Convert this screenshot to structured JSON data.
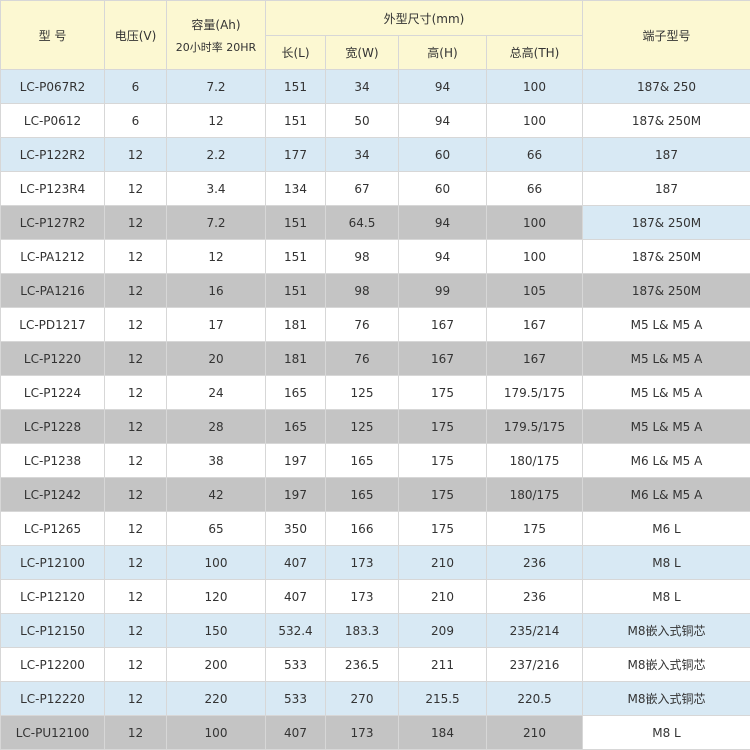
{
  "header": {
    "model": "型 号",
    "voltage": "电压(V)",
    "capacity_top": "容量(Ah)",
    "capacity_sub": "20小时率  20HR",
    "dimensions": "外型尺寸(mm)",
    "length": "长(L)",
    "width": "宽(W)",
    "height": "高(H)",
    "total_height": "总高(TH)",
    "terminal": "端子型号"
  },
  "rows": [
    {
      "model": "LC-P067R2",
      "voltage": "6",
      "capacity": "7.2",
      "length": "151",
      "width": "34",
      "height": "94",
      "total_height": "100",
      "terminal": "187& 250",
      "row_style": "blue",
      "terminal_style": "blue"
    },
    {
      "model": "LC-P0612",
      "voltage": "6",
      "capacity": "12",
      "length": "151",
      "width": "50",
      "height": "94",
      "total_height": "100",
      "terminal": "187& 250M",
      "row_style": "white",
      "terminal_style": "white"
    },
    {
      "model": "LC-P122R2",
      "voltage": "12",
      "capacity": "2.2",
      "length": "177",
      "width": "34",
      "height": "60",
      "total_height": "66",
      "terminal": "187",
      "row_style": "blue",
      "terminal_style": "blue"
    },
    {
      "model": "LC-P123R4",
      "voltage": "12",
      "capacity": "3.4",
      "length": "134",
      "width": "67",
      "height": "60",
      "total_height": "66",
      "terminal": "187",
      "row_style": "white",
      "terminal_style": "white"
    },
    {
      "model": "LC-P127R2",
      "voltage": "12",
      "capacity": "7.2",
      "length": "151",
      "width": "64.5",
      "height": "94",
      "total_height": "100",
      "terminal": "187& 250M",
      "row_style": "gray",
      "terminal_style": "blue"
    },
    {
      "model": "LC-PA1212",
      "voltage": "12",
      "capacity": "12",
      "length": "151",
      "width": "98",
      "height": "94",
      "total_height": "100",
      "terminal": "187& 250M",
      "row_style": "white",
      "terminal_style": "white"
    },
    {
      "model": "LC-PA1216",
      "voltage": "12",
      "capacity": "16",
      "length": "151",
      "width": "98",
      "height": "99",
      "total_height": "105",
      "terminal": "187& 250M",
      "row_style": "gray",
      "terminal_style": "gray"
    },
    {
      "model": "LC-PD1217",
      "voltage": "12",
      "capacity": "17",
      "length": "181",
      "width": "76",
      "height": "167",
      "total_height": "167",
      "terminal": "M5 L& M5 A",
      "row_style": "white",
      "terminal_style": "white"
    },
    {
      "model": "LC-P1220",
      "voltage": "12",
      "capacity": "20",
      "length": "181",
      "width": "76",
      "height": "167",
      "total_height": "167",
      "terminal": "M5 L& M5 A",
      "row_style": "gray",
      "terminal_style": "gray"
    },
    {
      "model": "LC-P1224",
      "voltage": "12",
      "capacity": "24",
      "length": "165",
      "width": "125",
      "height": "175",
      "total_height": "179.5/175",
      "terminal": "M5 L& M5 A",
      "row_style": "white",
      "terminal_style": "white"
    },
    {
      "model": "LC-P1228",
      "voltage": "12",
      "capacity": "28",
      "length": "165",
      "width": "125",
      "height": "175",
      "total_height": "179.5/175",
      "terminal": "M5 L& M5 A",
      "row_style": "gray",
      "terminal_style": "gray"
    },
    {
      "model": "LC-P1238",
      "voltage": "12",
      "capacity": "38",
      "length": "197",
      "width": "165",
      "height": "175",
      "total_height": "180/175",
      "terminal": "M6 L& M5 A",
      "row_style": "white",
      "terminal_style": "white"
    },
    {
      "model": "LC-P1242",
      "voltage": "12",
      "capacity": "42",
      "length": "197",
      "width": "165",
      "height": "175",
      "total_height": "180/175",
      "terminal": "M6 L& M5 A",
      "row_style": "gray",
      "terminal_style": "gray"
    },
    {
      "model": "LC-P1265",
      "voltage": "12",
      "capacity": "65",
      "length": "350",
      "width": "166",
      "height": "175",
      "total_height": "175",
      "terminal": "M6 L",
      "row_style": "white",
      "terminal_style": "white"
    },
    {
      "model": "LC-P12100",
      "voltage": "12",
      "capacity": "100",
      "length": "407",
      "width": "173",
      "height": "210",
      "total_height": "236",
      "terminal": "M8 L",
      "row_style": "blue",
      "terminal_style": "blue"
    },
    {
      "model": "LC-P12120",
      "voltage": "12",
      "capacity": "120",
      "length": "407",
      "width": "173",
      "height": "210",
      "total_height": "236",
      "terminal": "M8 L",
      "row_style": "white",
      "terminal_style": "white"
    },
    {
      "model": "LC-P12150",
      "voltage": "12",
      "capacity": "150",
      "length": "532.4",
      "width": "183.3",
      "height": "209",
      "total_height": "235/214",
      "terminal": "M8嵌入式铜芯",
      "row_style": "blue",
      "terminal_style": "blue"
    },
    {
      "model": "LC-P12200",
      "voltage": "12",
      "capacity": "200",
      "length": "533",
      "width": "236.5",
      "height": "211",
      "total_height": "237/216",
      "terminal": "M8嵌入式铜芯",
      "row_style": "white",
      "terminal_style": "white"
    },
    {
      "model": "LC-P12220",
      "voltage": "12",
      "capacity": "220",
      "length": "533",
      "width": "270",
      "height": "215.5",
      "total_height": "220.5",
      "terminal": "M8嵌入式铜芯",
      "row_style": "blue",
      "terminal_style": "blue"
    },
    {
      "model": "LC-PU12100",
      "voltage": "12",
      "capacity": "100",
      "length": "407",
      "width": "173",
      "height": "184",
      "total_height": "210",
      "terminal": "M8 L",
      "row_style": "gray",
      "terminal_style": "white"
    }
  ]
}
